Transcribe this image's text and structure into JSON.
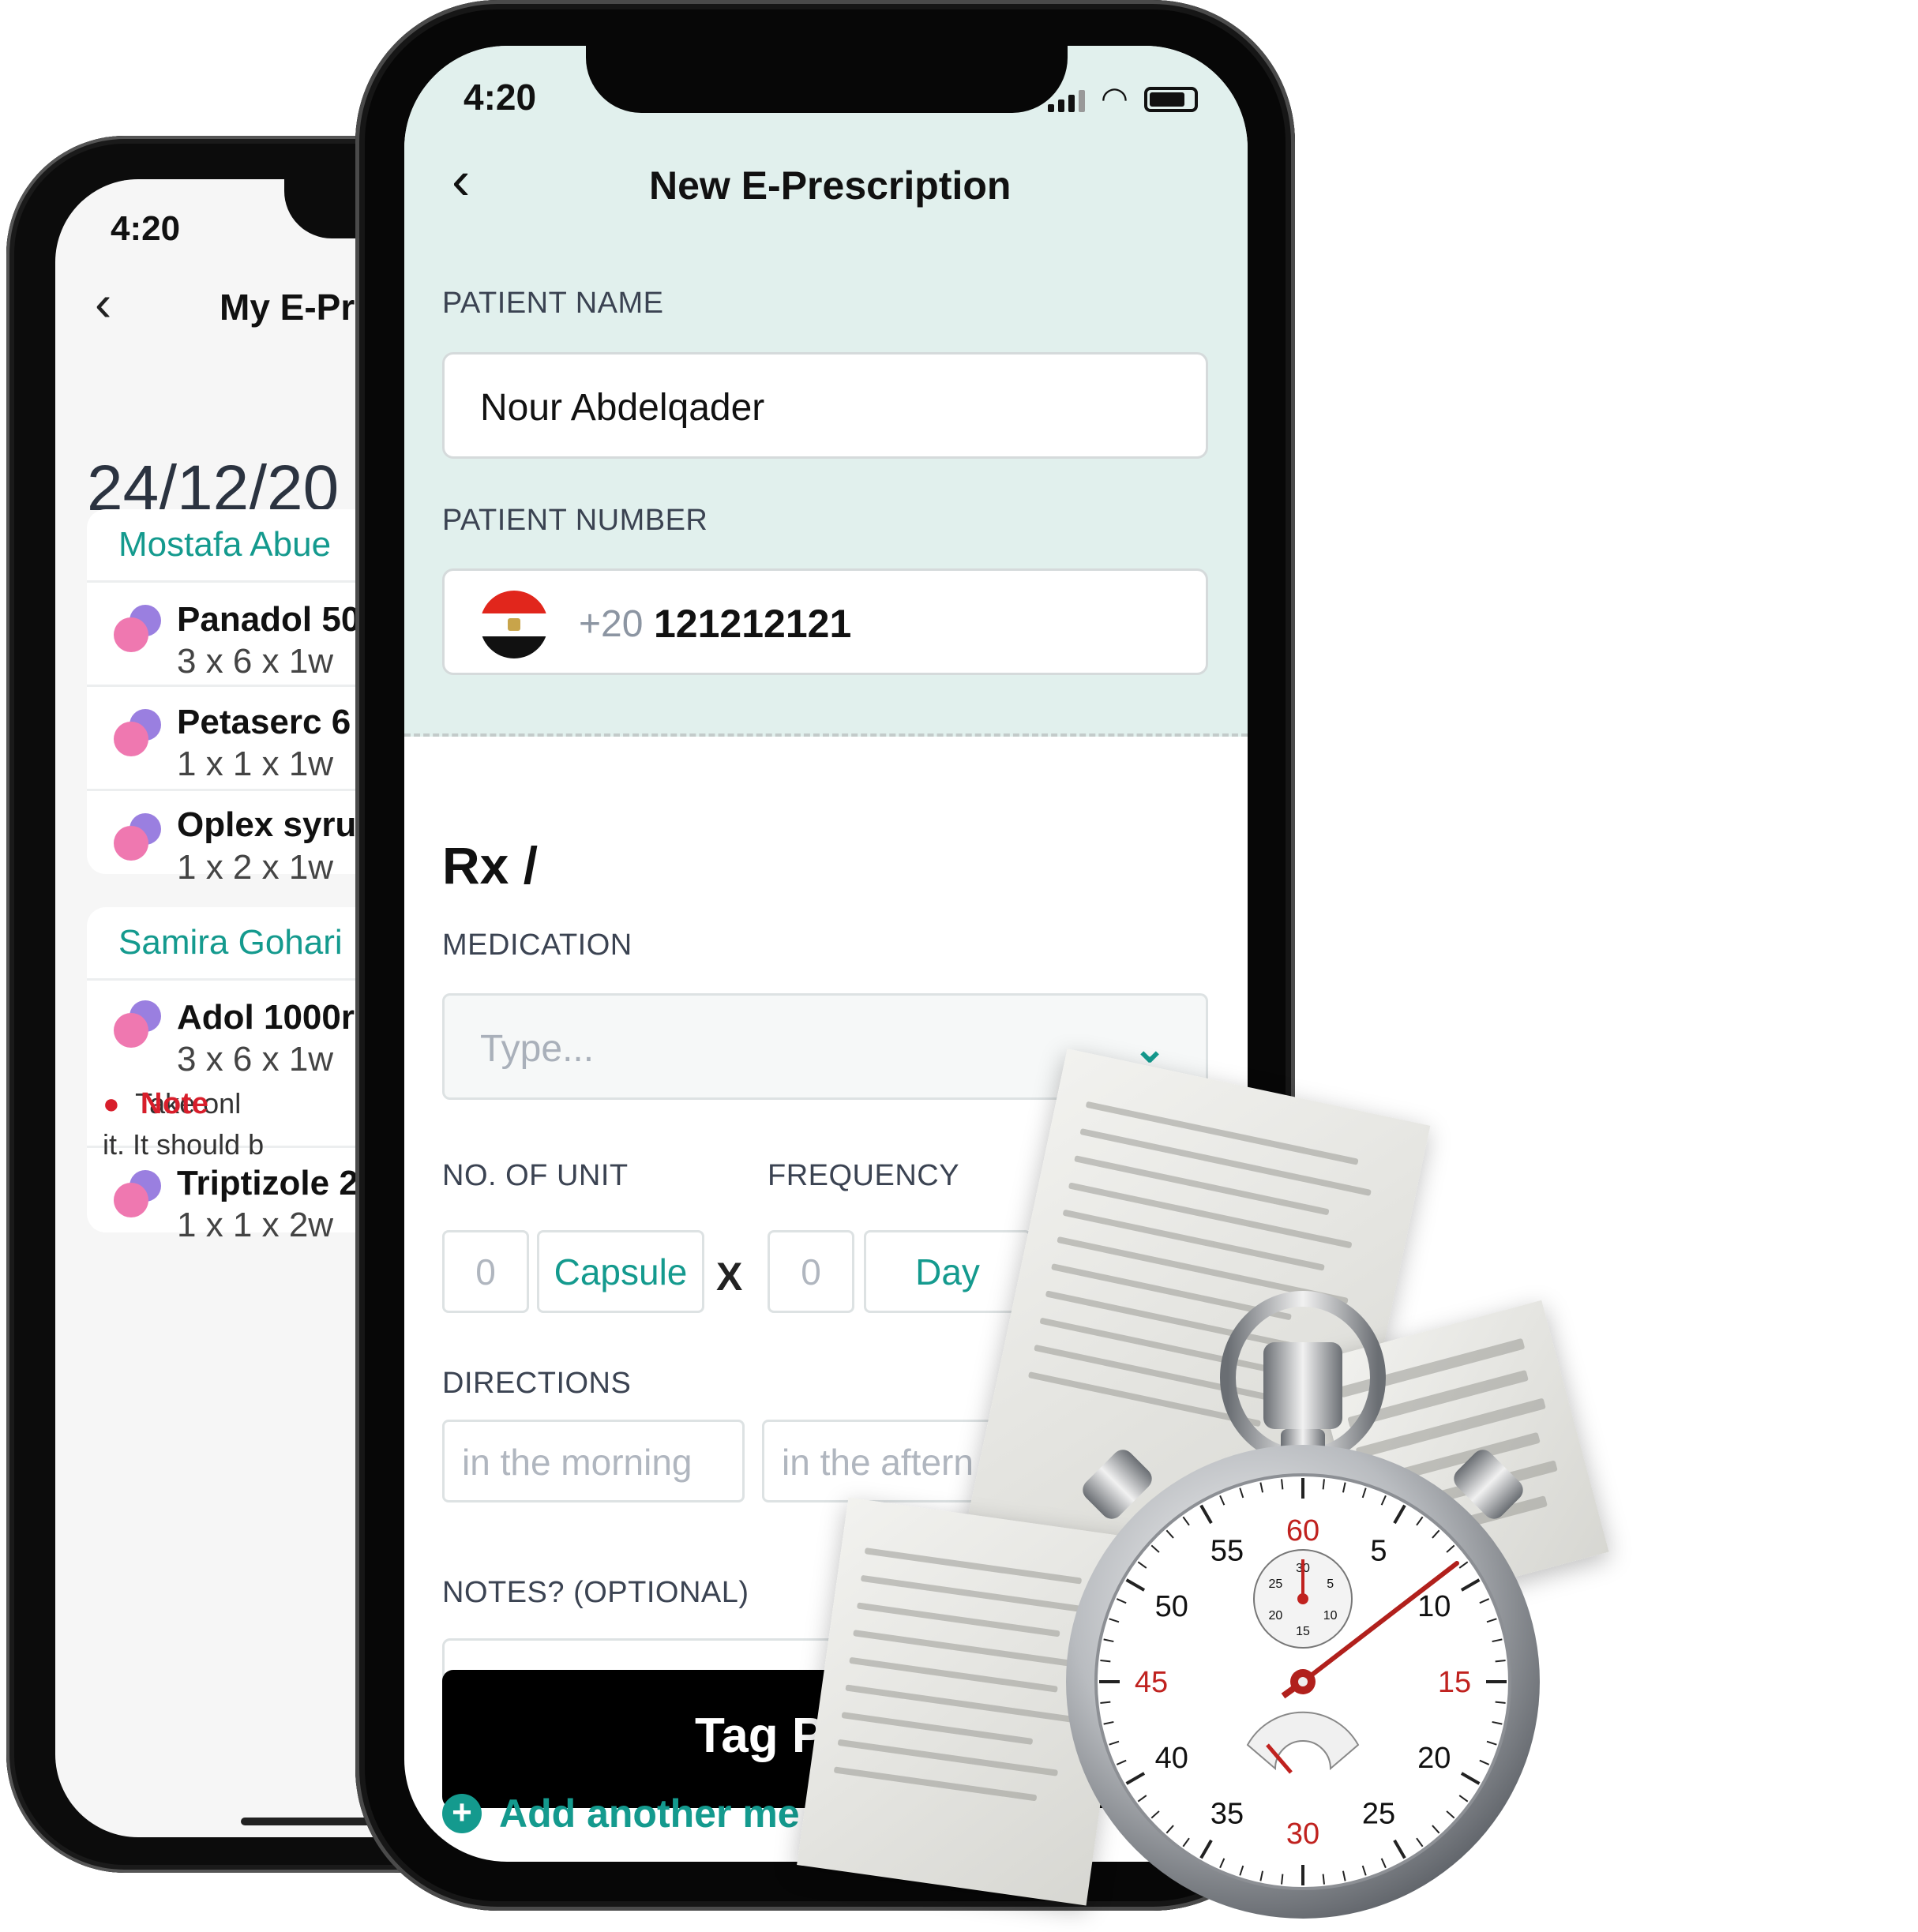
{
  "back_phone": {
    "time": "4:20",
    "title": "My E-Pr",
    "date": "24/12/20",
    "groups": [
      {
        "patient": "Mostafa Abue",
        "items": [
          {
            "name": "Panadol 50",
            "dose": "3 x 6 x 1w"
          },
          {
            "name": "Petaserc 6",
            "dose": "1 x 1 x 1w"
          },
          {
            "name": "Oplex syru",
            "dose": "1 x 2 x 1w"
          }
        ]
      },
      {
        "patient": "Samira Gohari",
        "items": [
          {
            "name": "Adol 1000r",
            "dose": "3 x 6 x 1w"
          },
          {
            "name": "Triptizole 2",
            "dose": "1 x 1 x 2w"
          }
        ],
        "note_label": "Note",
        "note_line1": "Take onl",
        "note_line2": "it. It should b"
      }
    ]
  },
  "front_phone": {
    "time": "4:20",
    "title": "New E-Prescription",
    "patient_name_label": "PATIENT NAME",
    "patient_name_value": "Nour Abdelqader",
    "patient_number_label": "PATIENT NUMBER",
    "country_code": "+20",
    "patient_number_value": "121212121",
    "rx": "Rx /",
    "medication_label": "MEDICATION",
    "medication_placeholder": "Type...",
    "units_label": "NO. OF UNIT",
    "frequency_label": "FREQUENCY",
    "units_value": "0",
    "unit_type": "Capsule",
    "times_sign": "X",
    "frequency_value": "0",
    "frequency_period": "Day",
    "directions_label": "DIRECTIONS",
    "direction_1": "in the morning",
    "direction_2": "in the aftern",
    "notes_label": "NOTES? (OPTIONAL)",
    "tag_button": "Tag P",
    "add_another": "Add another me"
  },
  "stopwatch": {
    "outer_numbers": [
      "60",
      "5",
      "10",
      "15",
      "20",
      "25",
      "30",
      "35",
      "40",
      "45",
      "50",
      "55"
    ],
    "inner_numbers": [
      "30",
      "5",
      "10",
      "15",
      "20",
      "25"
    ]
  },
  "colors": {
    "teal": "#149a8e",
    "mint_header": "#e1f0ed",
    "note_red": "#d81e2b",
    "stopwatch_red": "#c0221f"
  }
}
